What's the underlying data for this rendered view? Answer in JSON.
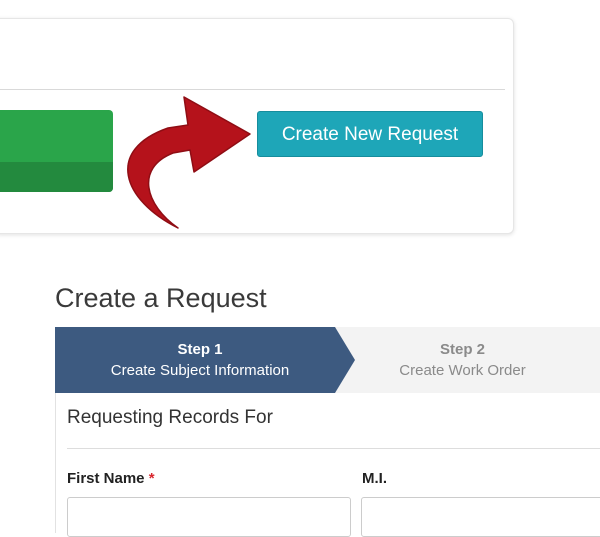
{
  "top_card": {
    "create_button_label": "Create New Request"
  },
  "page": {
    "title": "Create a Request"
  },
  "steps": [
    {
      "title": "Step 1",
      "subtitle": "Create Subject Information",
      "active": true
    },
    {
      "title": "Step 2",
      "subtitle": "Create Work Order",
      "active": false
    }
  ],
  "form": {
    "section_title": "Requesting Records For",
    "first_name_label": "First Name",
    "required_marker": "*",
    "mi_label": "M.I.",
    "first_name_value": "",
    "mi_value": ""
  },
  "colors": {
    "green_button": "#2aa54a",
    "create_button": "#1ea6b8",
    "arrow": "#b5121b",
    "active_step": "#3d5a80",
    "required": "#d9272e"
  },
  "icons": {
    "callout_arrow": "curved-arrow-icon"
  }
}
